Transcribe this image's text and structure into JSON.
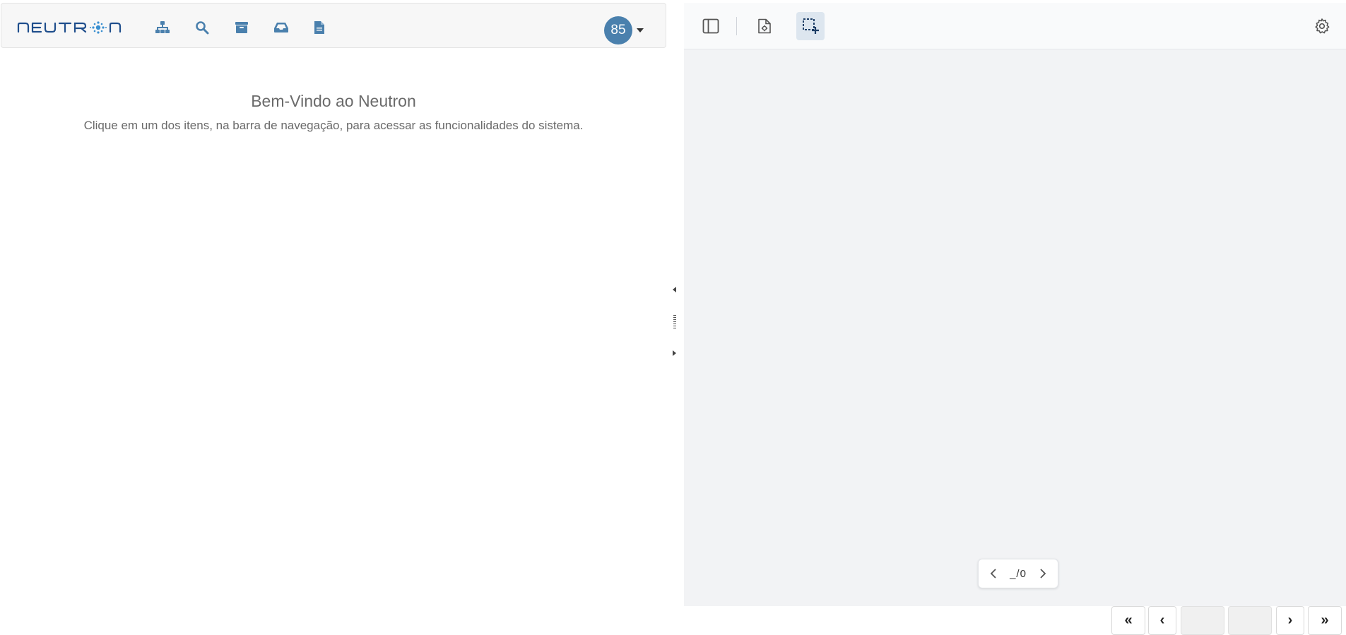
{
  "app": {
    "logo_text": "NEUTRON",
    "accent_color": "#4a80ad",
    "logo_color": "#1f4e8c"
  },
  "navbar": {
    "icons": [
      {
        "name": "sitemap-icon"
      },
      {
        "name": "search-icon"
      },
      {
        "name": "archive-icon"
      },
      {
        "name": "inbox-icon"
      },
      {
        "name": "document-icon"
      }
    ],
    "user": {
      "avatar_label": "85"
    }
  },
  "welcome": {
    "title": "Bem-Vindo ao Neutron",
    "subtitle": "Clique em um dos itens, na barra de navegação, para acessar as funcionalidades do sistema."
  },
  "viewer": {
    "toolbar": {
      "buttons": [
        {
          "name": "sidebar-toggle-icon"
        },
        {
          "name": "document-settings-icon"
        },
        {
          "name": "selection-add-icon",
          "active": true
        },
        {
          "name": "gear-icon"
        }
      ]
    },
    "page_indicator": {
      "current": "_",
      "separator": "/",
      "total": "0"
    }
  },
  "pager": {
    "first_label": "«",
    "prev_label": "‹",
    "next_label": "›",
    "last_label": "»"
  }
}
